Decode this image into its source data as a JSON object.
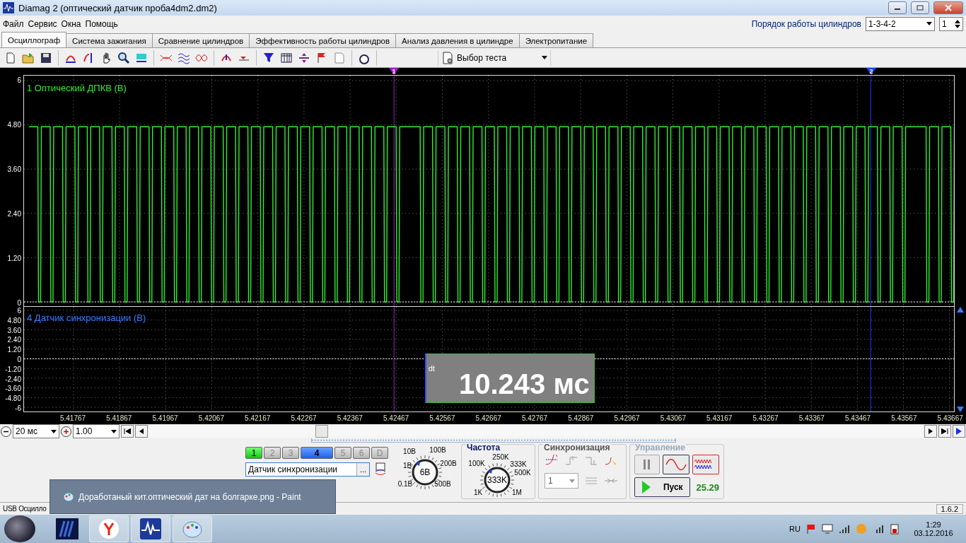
{
  "window": {
    "title": "Diamag 2 (оптический датчик проба4dm2.dm2)"
  },
  "menu": [
    "Файл",
    "Сервис",
    "Окна",
    "Помощь"
  ],
  "cylinder_order": {
    "label": "Порядок работы цилиндров",
    "value": "1-3-4-2",
    "spin_value": "1"
  },
  "tabs": [
    {
      "label": "Осциллограф",
      "selected": true
    },
    {
      "label": "Система зажигания",
      "selected": false
    },
    {
      "label": "Сравнение цилиндров",
      "selected": false
    },
    {
      "label": "Эффективность работы цилиндров",
      "selected": false
    },
    {
      "label": "Анализ давления в цилиндре",
      "selected": false
    },
    {
      "label": "Электропитание",
      "selected": false
    }
  ],
  "toolbar": {
    "test_select": "Выбор теста"
  },
  "scope": {
    "channels": [
      {
        "label": "1 Оптический ДПКВ (В)",
        "color": "#33ee33",
        "kind": "square",
        "y_ticks": [
          "6",
          "4.80",
          "3.60",
          "2.40",
          "1.20",
          "0"
        ]
      },
      {
        "label": "4 Датчик синхронизации (В)",
        "color": "#3a7cff",
        "kind": "flat",
        "y_ticks": [
          "6",
          "4.80",
          "3.60",
          "2.40",
          "1.20",
          "0",
          "-1.20",
          "-2.40",
          "-3.60",
          "-4.80",
          "-6"
        ]
      }
    ],
    "cursors": [
      {
        "label": "1",
        "color": "#a020c0"
      },
      {
        "label": "2",
        "color": "#2040ff"
      }
    ],
    "readout": {
      "label": "dt",
      "value": "10.243 мс"
    },
    "x_ticks": [
      "5.41767",
      "5.41867",
      "5.41967",
      "5.42067",
      "5.42167",
      "5.42267",
      "5.42367",
      "5.42467",
      "5.42567",
      "5.42667",
      "5.42767",
      "5.42867",
      "5.42967",
      "5.43067",
      "5.43167",
      "5.43267",
      "5.43367",
      "5.43467",
      "5.43567",
      "5.43667"
    ]
  },
  "zoom": {
    "time": "20 мс",
    "gain": "1.00"
  },
  "channel_buttons": [
    {
      "label": "1",
      "on": true,
      "selected": false
    },
    {
      "label": "2",
      "on": false,
      "selected": false
    },
    {
      "label": "3",
      "on": false,
      "selected": false
    },
    {
      "label": "4",
      "on": false,
      "selected": true
    },
    {
      "label": "5",
      "on": false,
      "selected": false
    },
    {
      "label": "6",
      "on": false,
      "selected": false
    },
    {
      "label": "D",
      "on": false,
      "selected": false
    }
  ],
  "source_field": {
    "value": "Датчик синхронизации",
    "button": "..."
  },
  "voltage_knob": {
    "value": "6В",
    "labels": [
      "10В",
      "100В",
      "1В",
      "200В",
      "0.1В",
      "500В"
    ]
  },
  "frequency": {
    "title": "Частота",
    "value": "333K",
    "labels": [
      "250K",
      "100K",
      "333K",
      "500K",
      "1K",
      "1M"
    ]
  },
  "sync": {
    "title": "Синхронизация",
    "channel": "1"
  },
  "control": {
    "title": "Управление",
    "start": "Пуск",
    "reading": "25.29"
  },
  "status_bar": {
    "text": "USB Осцилло",
    "version": "1.6.2"
  },
  "taskbar_popup": {
    "text": "Доработаный кит.оптический дат на болгарке.png - Paint"
  },
  "taskbar": {
    "language": "RU",
    "time": "1:29",
    "date": "03.12.2016"
  }
}
